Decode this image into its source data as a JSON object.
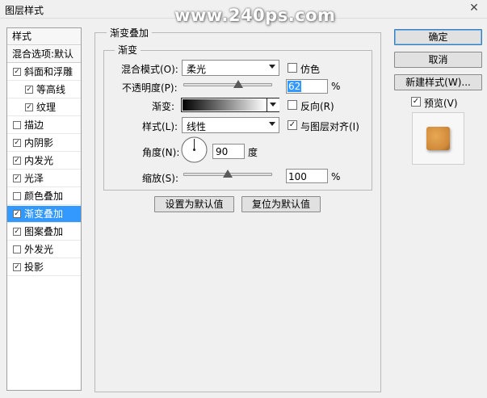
{
  "window": {
    "title": "图层样式",
    "close_glyph": "✕"
  },
  "watermark": "www.240ps.com",
  "left_panel": {
    "header_label": "样式",
    "blend_options_label": "混合选项:默认",
    "items": [
      {
        "label": "斜面和浮雕",
        "checked": true,
        "indent": false
      },
      {
        "label": "等高线",
        "checked": true,
        "indent": true
      },
      {
        "label": "纹理",
        "checked": true,
        "indent": true
      },
      {
        "label": "描边",
        "checked": false,
        "indent": false
      },
      {
        "label": "内阴影",
        "checked": true,
        "indent": false
      },
      {
        "label": "内发光",
        "checked": true,
        "indent": false
      },
      {
        "label": "光泽",
        "checked": true,
        "indent": false
      },
      {
        "label": "颜色叠加",
        "checked": false,
        "indent": false
      },
      {
        "label": "渐变叠加",
        "checked": true,
        "indent": false,
        "selected": true
      },
      {
        "label": "图案叠加",
        "checked": true,
        "indent": false
      },
      {
        "label": "外发光",
        "checked": false,
        "indent": false
      },
      {
        "label": "投影",
        "checked": true,
        "indent": false
      }
    ]
  },
  "gradient_overlay": {
    "group_title": "渐变叠加",
    "subgroup_title": "渐变",
    "blend_mode": {
      "label": "混合模式(O):",
      "value": "柔光"
    },
    "dither": {
      "label": "仿色",
      "checked": false
    },
    "opacity": {
      "label": "不透明度(P):",
      "value": "62",
      "unit": "%",
      "fraction": 0.62
    },
    "gradient": {
      "label": "渐变:",
      "color_start": "#000000",
      "color_end": "#ffffff"
    },
    "reverse": {
      "label": "反向(R)",
      "checked": false
    },
    "style": {
      "label": "样式(L):",
      "value": "线性"
    },
    "align_with_layer": {
      "label": "与图层对齐(I)",
      "checked": true
    },
    "angle": {
      "label": "角度(N):",
      "value": "90",
      "unit": "度"
    },
    "scale": {
      "label": "缩放(S):",
      "value": "100",
      "unit": "%",
      "fraction": 0.5
    },
    "set_default_button": "设置为默认值",
    "reset_default_button": "复位为默认值"
  },
  "right_panel": {
    "ok_button": "确定",
    "cancel_button": "取消",
    "new_style_button": "新建样式(W)...",
    "preview": {
      "label": "预览(V)",
      "checked": true
    }
  },
  "colors": {
    "selection": "#3399ff",
    "preview_swatch": "#d08a3a",
    "highlight_text_bg": "#3399ff"
  },
  "icons": {
    "check": "✓"
  }
}
